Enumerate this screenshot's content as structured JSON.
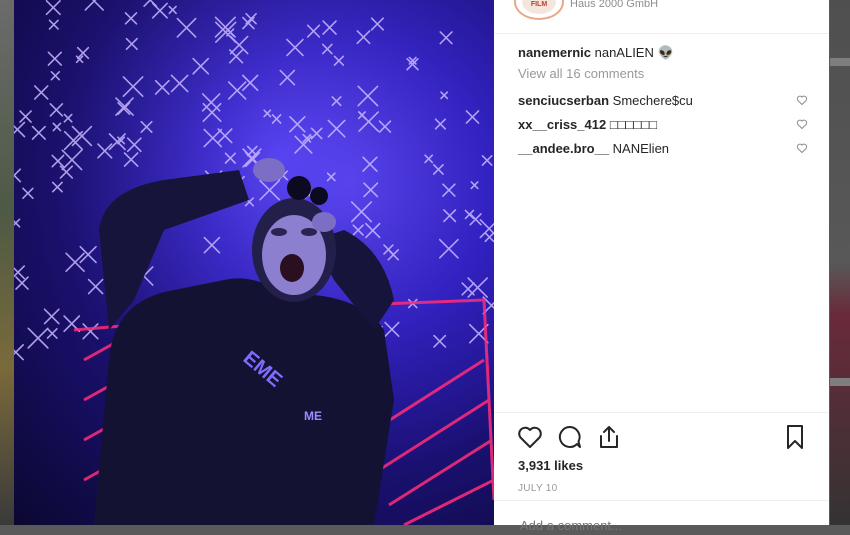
{
  "header": {
    "location": "Haus 2000 GmbH"
  },
  "caption": {
    "username": "nanemernic",
    "text": "nanALIEN 👽"
  },
  "view_all_comments": "View all 16 comments",
  "comments": [
    {
      "username": "senciucserban",
      "text": "Smechere$cu"
    },
    {
      "username": "xx__criss_412",
      "text": "□□□□□□"
    },
    {
      "username": "__andee.bro__",
      "text": "NANElien"
    }
  ],
  "likes": {
    "count": "3,931",
    "label": "likes"
  },
  "date": "JULY 10",
  "add_comment": {
    "placeholder": "Add a comment..."
  },
  "icons": {
    "like": "heart-icon",
    "comment": "comment-bubble-icon",
    "share": "share-icon",
    "save": "bookmark-icon"
  }
}
